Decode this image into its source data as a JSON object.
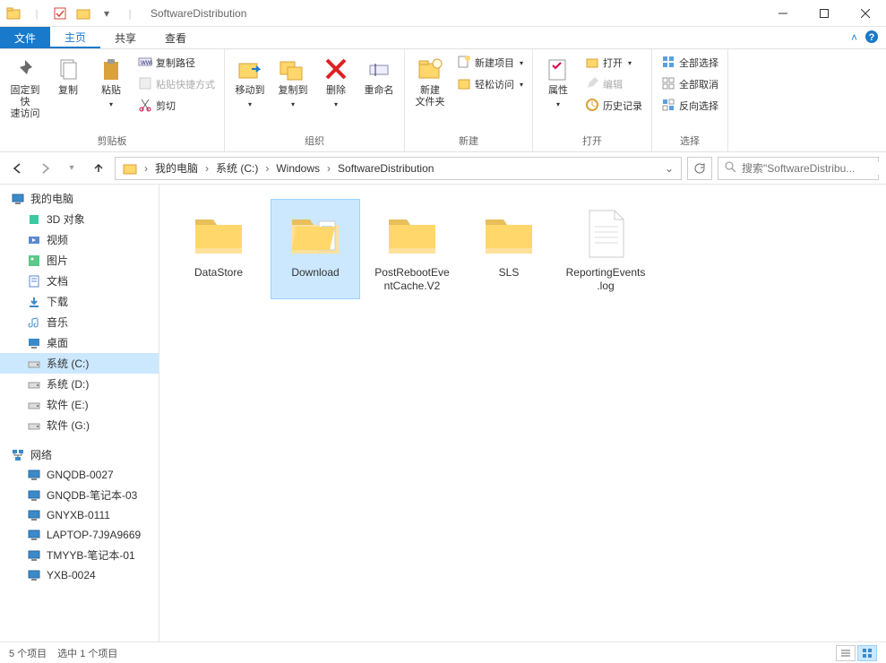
{
  "window": {
    "title": "SoftwareDistribution"
  },
  "tabs": {
    "file": "文件",
    "home": "主页",
    "share": "共享",
    "view": "查看"
  },
  "ribbon": {
    "pin": "固定到快\n速访问",
    "copy": "复制",
    "paste": "粘贴",
    "copypath": "复制路径",
    "pasteshortcut": "粘贴快捷方式",
    "cut": "剪切",
    "clipboard": "剪贴板",
    "moveto": "移动到",
    "copyto": "复制到",
    "delete": "删除",
    "rename": "重命名",
    "organize": "组织",
    "newfolder": "新建\n文件夹",
    "newitem": "新建项目",
    "easyaccess": "轻松访问",
    "new": "新建",
    "properties": "属性",
    "open": "打开",
    "edit": "编辑",
    "history": "历史记录",
    "openg": "打开",
    "selectall": "全部选择",
    "selectnone": "全部取消",
    "invertsel": "反向选择",
    "select": "选择"
  },
  "breadcrumb": {
    "pc": "我的电脑",
    "drive": "系统 (C:)",
    "win": "Windows",
    "folder": "SoftwareDistribution"
  },
  "search": {
    "placeholder": "搜索\"SoftwareDistribu..."
  },
  "sidebar": {
    "pc": "我的电脑",
    "items": [
      {
        "label": "3D 对象"
      },
      {
        "label": "视频"
      },
      {
        "label": "图片"
      },
      {
        "label": "文档"
      },
      {
        "label": "下载"
      },
      {
        "label": "音乐"
      },
      {
        "label": "桌面"
      },
      {
        "label": "系统 (C:)"
      },
      {
        "label": "系统 (D:)"
      },
      {
        "label": "软件 (E:)"
      },
      {
        "label": "软件 (G:)"
      }
    ],
    "network": "网络",
    "hosts": [
      {
        "label": "GNQDB-0027"
      },
      {
        "label": "GNQDB-笔记本-03"
      },
      {
        "label": "GNYXB-0111"
      },
      {
        "label": "LAPTOP-7J9A9669"
      },
      {
        "label": "TMYYB-笔记本-01"
      },
      {
        "label": "YXB-0024"
      }
    ]
  },
  "files": [
    {
      "name": "DataStore",
      "type": "folder"
    },
    {
      "name": "Download",
      "type": "folder",
      "selected": true
    },
    {
      "name": "PostRebootEventCache.V2",
      "type": "folder"
    },
    {
      "name": "SLS",
      "type": "folder"
    },
    {
      "name": "ReportingEvents.log",
      "type": "file"
    }
  ],
  "status": {
    "count": "5 个项目",
    "selected": "选中 1 个项目"
  }
}
